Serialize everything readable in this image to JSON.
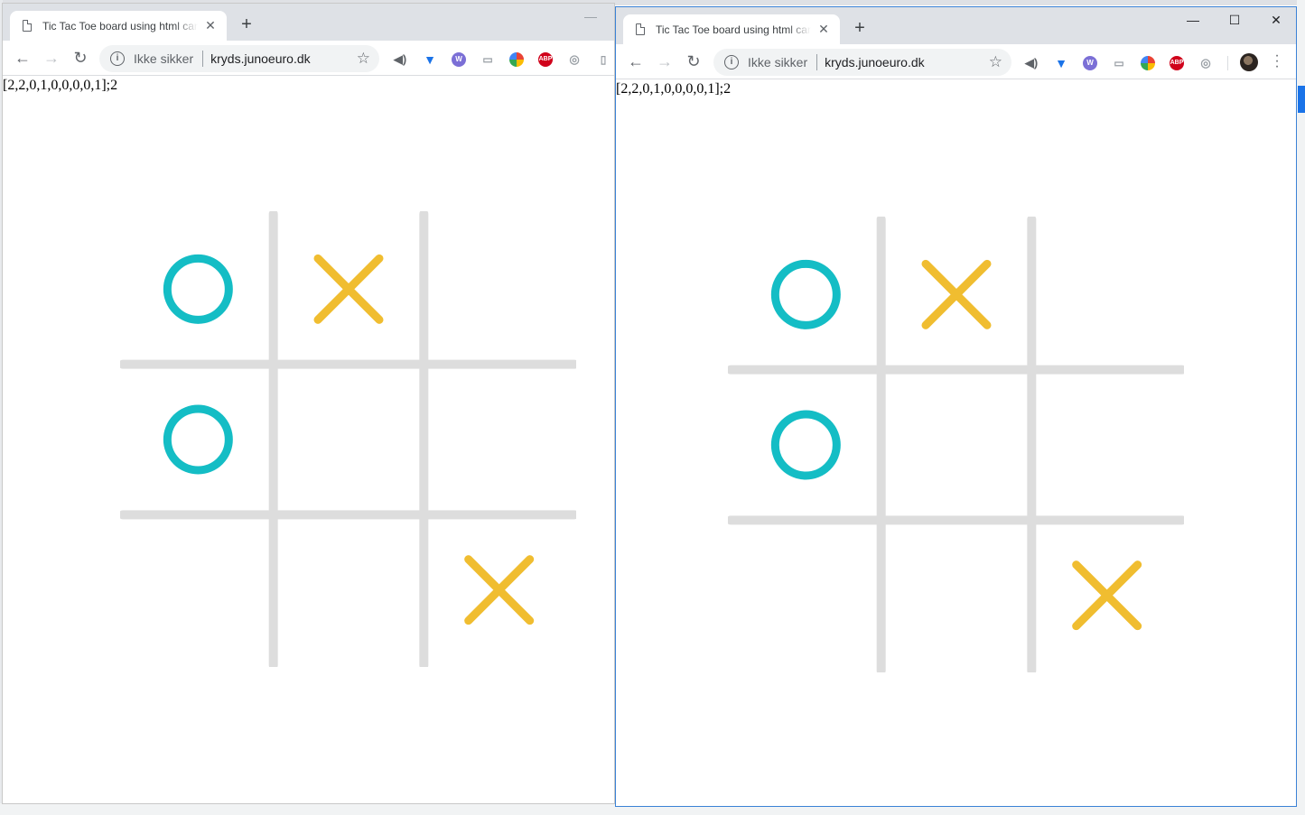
{
  "windows": [
    {
      "tab_title": "Tic Tac Toe board using html canvas",
      "omnibox": {
        "security": "Ikke sikker",
        "url": "kryds.junoeuro.dk"
      },
      "state_text": "[2,2,0,1,0,0,0,0,1];2",
      "board": [
        "O",
        "X",
        "",
        "O",
        "",
        "",
        "",
        "",
        "X"
      ]
    },
    {
      "tab_title": "Tic Tac Toe board using html canvas",
      "omnibox": {
        "security": "Ikke sikker",
        "url": "kryds.junoeuro.dk"
      },
      "state_text": "[2,2,0,1,0,0,0,0,1];2",
      "board": [
        "O",
        "X",
        "",
        "O",
        "",
        "",
        "",
        "",
        "X"
      ]
    }
  ],
  "colors": {
    "grid": "#dddddd",
    "o": "#14bdc5",
    "x": "#f0bd30"
  },
  "icons": [
    "back-icon",
    "forward-icon",
    "reload-icon",
    "info-icon",
    "star-icon",
    "extension-icons",
    "new-tab-icon",
    "close-tab-icon",
    "minimize-icon",
    "maximize-icon",
    "close-window-icon",
    "menu-icon",
    "avatar"
  ]
}
